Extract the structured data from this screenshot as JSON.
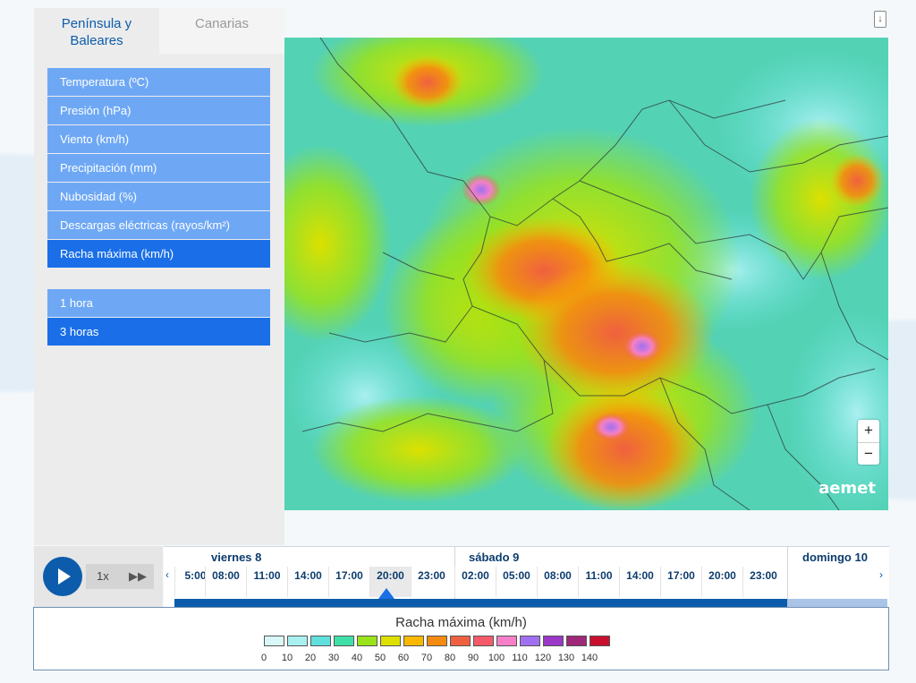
{
  "tabs": [
    {
      "label": "Península y Baleares",
      "active": true
    },
    {
      "label": "Canarias",
      "active": false
    }
  ],
  "menu": {
    "variables": [
      {
        "label": "Temperatura (ºC)",
        "active": false
      },
      {
        "label": "Presión (hPa)",
        "active": false
      },
      {
        "label": "Viento (km/h)",
        "active": false
      },
      {
        "label": "Precipitación (mm)",
        "active": false
      },
      {
        "label": "Nubosidad (%)",
        "active": false
      },
      {
        "label": "Descargas eléctricas (rayos/km²)",
        "active": false
      },
      {
        "label": "Racha máxima (km/h)",
        "active": true
      }
    ],
    "intervals": [
      {
        "label": "1 hora",
        "active": false
      },
      {
        "label": "3 horas",
        "active": true
      }
    ]
  },
  "map": {
    "zoom_in": "+",
    "zoom_out": "−",
    "logo": "aemet"
  },
  "player": {
    "speed": "1x"
  },
  "timeline": {
    "days": [
      "viernes 8",
      "sábado 9",
      "domingo 10"
    ],
    "hours_day1": [
      "5:00",
      "08:00",
      "11:00",
      "14:00",
      "17:00",
      "20:00",
      "23:00"
    ],
    "hours_day2": [
      "02:00",
      "05:00",
      "08:00",
      "11:00",
      "14:00",
      "17:00",
      "20:00",
      "23:00"
    ],
    "selected": "20:00"
  },
  "legend": {
    "title": "Racha máxima (km/h)",
    "colors": [
      "#d9f7f7",
      "#aaf0f0",
      "#5fe0dc",
      "#3fe0a8",
      "#9ae21a",
      "#dde000",
      "#f8b800",
      "#f58a10",
      "#f06040",
      "#f55a6a",
      "#f580c8",
      "#a070f0",
      "#9a38c8",
      "#a02878",
      "#c8102e"
    ],
    "values": [
      "0",
      "10",
      "20",
      "30",
      "40",
      "50",
      "60",
      "70",
      "80",
      "90",
      "100",
      "110",
      "120",
      "130",
      "140"
    ]
  }
}
